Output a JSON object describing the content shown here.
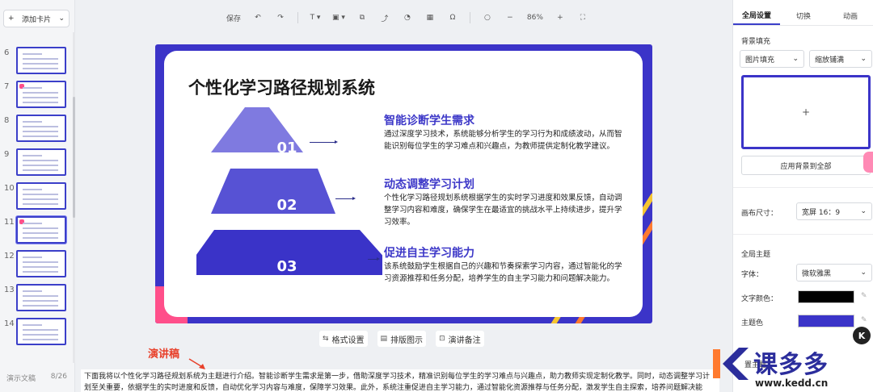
{
  "left": {
    "add_card": "添加卡片",
    "add_card_chevron": "⌄",
    "slides": [
      {
        "num": "6",
        "active": false
      },
      {
        "num": "7",
        "active": false
      },
      {
        "num": "8",
        "active": false
      },
      {
        "num": "9",
        "active": false
      },
      {
        "num": "10",
        "active": false
      },
      {
        "num": "11",
        "active": true
      },
      {
        "num": "12",
        "active": false
      },
      {
        "num": "13",
        "active": false
      },
      {
        "num": "14",
        "active": false
      }
    ],
    "footer_label": "演示文稿",
    "footer_page": "8/26"
  },
  "toolbar": {
    "save": "保存",
    "undo_icon": "↶",
    "redo_icon": "↷",
    "text_icon": "T ▾",
    "image_icon": "▣ ▾",
    "shape_icon": "⧉",
    "line_icon": "⤴",
    "chart_icon": "◔",
    "table_icon": "▦",
    "symbol_icon": "Ω",
    "search_icon": "○",
    "zoom_out": "−",
    "zoom": "86%",
    "zoom_in": "+",
    "fullscreen_icon": "⛶"
  },
  "slide": {
    "title": "个性化学习路径规划系统",
    "pyramid": [
      {
        "label": "01",
        "color": "#7f7ae0"
      },
      {
        "label": "02",
        "color": "#5752d4"
      },
      {
        "label": "03",
        "color": "#3a33c8"
      }
    ],
    "sections": [
      {
        "title": "智能诊断学生需求",
        "body": "通过深度学习技术，系统能够分析学生的学习行为和成绩波动，从而智能识别每位学生的学习难点和兴趣点，为教师提供定制化教学建议。"
      },
      {
        "title": "动态调整学习计划",
        "body": "个性化学习路径规划系统根据学生的实时学习进度和效果反馈，自动调整学习内容和难度，确保学生在最适宜的挑战水平上持续进步，提升学习效率。"
      },
      {
        "title": "促进自主学习能力",
        "body": "该系统鼓励学生根据自己的兴趣和节奏探索学习内容，通过智能化的学习资源推荐和任务分配，培养学生的自主学习能力和问题解决能力。"
      }
    ],
    "accent_blue": "#3b34c8",
    "accent_pink": "#ff4f8a",
    "accent_yellow": "#f6c531",
    "accent_orange": "#ff7a2e"
  },
  "under_slide": {
    "format": "格式设置",
    "layout": "排版图示",
    "notes": "演讲备注",
    "format_icon": "⇆",
    "layout_icon": "▤",
    "notes_icon": "⊡"
  },
  "speech": {
    "label": "演讲稿",
    "text": "下面我将以个性化学习路径规划系统为主题进行介绍。智能诊断学生需求是第一步，借助深度学习技术，精准识别每位学生的学习难点与兴趣点，助力教师实现定制化教学。同时，动态调整学习计划至关重要，依据学生的实时进度和反馈，自动优化学习内容与难度，保障学习效果。此外，系统注重促进自主学习能力，通过智能化资源推荐与任务分配，激发学生自主探索，培养问题解决能力。"
  },
  "right": {
    "tabs": [
      "全局设置",
      "切换",
      "动画"
    ],
    "bg_fill_label": "背景填充",
    "fill_type": "图片填充",
    "fill_mode": "缩放铺满",
    "preview_plus": "+",
    "apply_all": "应用背景到全部",
    "canvas_size_label": "画布尺寸：",
    "canvas_size": "宽屏 16：9",
    "theme_label": "全局主题",
    "font_label": "字体：",
    "font_value": "微软雅黑",
    "text_color_label": "文字颜色：",
    "text_color": "#000000",
    "theme_color_label": "主题色",
    "theme_color": "#3b34c8",
    "more_label": "置主题"
  },
  "watermark": {
    "brand": "课多多",
    "url": "www.kedd.cn",
    "k_badge": "K"
  }
}
